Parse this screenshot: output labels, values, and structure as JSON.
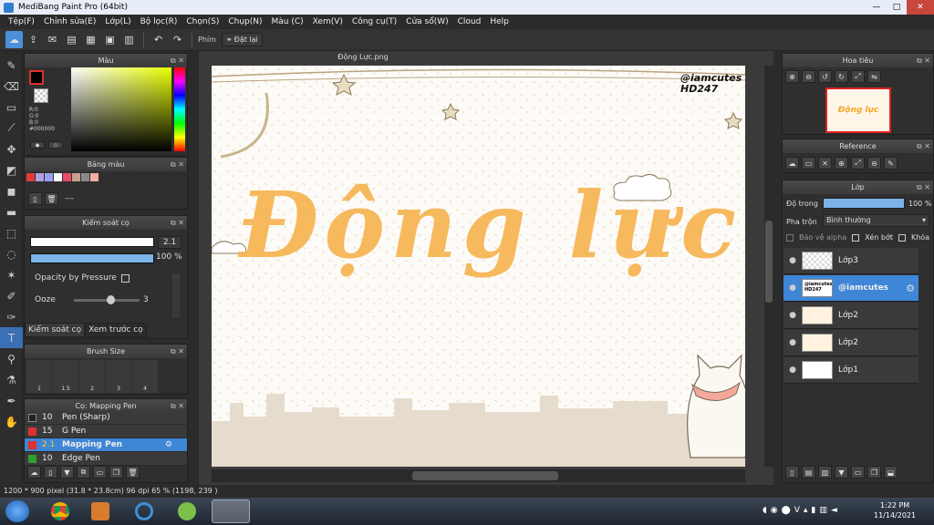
{
  "window": {
    "title": "MediBang Paint Pro (64bit)",
    "minimize": "—",
    "maximize": "□",
    "close": "✕"
  },
  "menu": [
    "Tệp(F)",
    "Chỉnh sửa(E)",
    "Lớp(L)",
    "Bộ lọc(R)",
    "Chọn(S)",
    "Chụp(N)",
    "Màu (C)",
    "Xem(V)",
    "Công cụ(T)",
    "Cửa sổ(W)",
    "Cloud",
    "Help"
  ],
  "toolbar": {
    "shortcut_label": "Phím",
    "reset_label": "Đặt lại"
  },
  "color_panel": {
    "title": "Màu",
    "r": "R:0",
    "g": "G:0",
    "b": "B:0",
    "hex": "#000000",
    "primary": "#000000",
    "secondary": "#ffffff"
  },
  "palette_panel": {
    "title": "Bảng màu",
    "colors": [
      "#e23b3b",
      "#b0a0e0",
      "#9aa0f0",
      "#ffffff",
      "#e84a6a",
      "#c8a090",
      "#8a8a8a",
      "#f0b0a0"
    ],
    "placeholder": "---"
  },
  "brush_control": {
    "title": "Kiểm soát cọ",
    "width_value": "2.1",
    "opacity_value": "100 %",
    "opacity_pressure_label": "Opacity by Pressure",
    "ooze_label": "Ooze",
    "ooze_value": "3",
    "tab_control": "Kiểm soát cọ",
    "tab_preview": "Xem trước cọ"
  },
  "brush_size": {
    "title": "Brush Size",
    "sizes": [
      "1",
      "1.5",
      "2",
      "3",
      "4"
    ]
  },
  "brush_list": {
    "title": "Cọ: Mapping Pen",
    "items": [
      {
        "size": "10",
        "name": "Pen (Sharp)",
        "color": "#222222"
      },
      {
        "size": "15",
        "name": "G Pen",
        "color": "#e03030"
      },
      {
        "size": "2.1",
        "name": "Mapping Pen",
        "color": "#e03030",
        "selected": true
      },
      {
        "size": "10",
        "name": "Edge Pen",
        "color": "#2ca02c"
      }
    ]
  },
  "document": {
    "tab": "Động Lực.png",
    "main_text": "Động lực",
    "watermark_line1": "@iamcutes",
    "watermark_line2": "HD247"
  },
  "navigator": {
    "title": "Hoa tiêu"
  },
  "reference": {
    "title": "Reference"
  },
  "layer_panel": {
    "title": "Lớp",
    "opacity_label": "Độ trong",
    "opacity_value": "100 %",
    "opacity_fill": 1.0,
    "blend_label": "Pha trộn",
    "blend_value": "Bình thường",
    "protect_alpha": "Bảo vệ alpha",
    "clipping": "Xén bớt",
    "lock": "Khóa",
    "layers": [
      {
        "name": "Lớp3",
        "selected": false
      },
      {
        "name": "@iamcutes",
        "selected": true,
        "thumb_text": "@iamcutes HD247"
      },
      {
        "name": "Lớp2",
        "selected": false
      },
      {
        "name": "Lớp2",
        "selected": false
      },
      {
        "name": "Lớp1",
        "selected": false
      }
    ]
  },
  "status": {
    "text": "1200 * 900 pixel   (31.8 * 23.8cm)   96 dpi   65 %   (1198, 239 )"
  },
  "taskbar": {
    "time": "1:22 PM",
    "date": "11/14/2021"
  },
  "colors": {
    "accent": "#3f86d6",
    "text_gradient_top": "#ffe0a0",
    "text_gradient_bottom": "#f5a623"
  }
}
